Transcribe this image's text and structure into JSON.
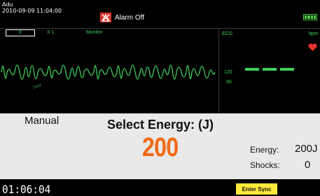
{
  "patient": {
    "name": "Adu",
    "datetime": "2010-09-09 11:04:00"
  },
  "alarm": {
    "label": "Alarm Off",
    "icon": "alarm-off-icon",
    "color": "#d9352b"
  },
  "battery": {
    "icon": "battery-icon",
    "color": "#4fd14a"
  },
  "ecg_panel": {
    "lead": "II",
    "gain": "X 1",
    "filter_mode": "Monitor",
    "amplitude_unit": "1mV",
    "trace_color": "#3fcf5a"
  },
  "hr_panel": {
    "label": "ECG",
    "unit": "bpm",
    "value_display": "— — —",
    "alarm_high": "120",
    "alarm_low": "50",
    "heart_icon": "heart-icon",
    "heart_color": "#e8342c"
  },
  "therapy": {
    "mode": "Manual",
    "prompt": "Select Energy: (J)",
    "selected_energy": "200",
    "energy_label": "Energy:",
    "energy_value": "200J",
    "shocks_label": "Shocks:",
    "shocks_value": "0",
    "accent_color": "#f26a15"
  },
  "footer": {
    "elapsed_time": "01:06:04",
    "sync_button_label": "Enter Sync",
    "sync_button_color": "#ffe93a"
  }
}
